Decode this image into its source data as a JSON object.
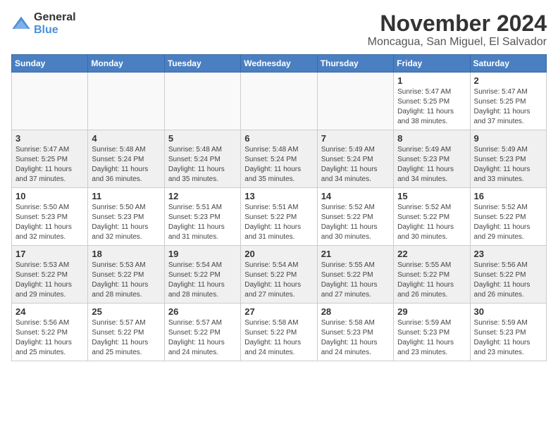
{
  "logo": {
    "general": "General",
    "blue": "Blue"
  },
  "header": {
    "month": "November 2024",
    "location": "Moncagua, San Miguel, El Salvador"
  },
  "weekdays": [
    "Sunday",
    "Monday",
    "Tuesday",
    "Wednesday",
    "Thursday",
    "Friday",
    "Saturday"
  ],
  "weeks": [
    [
      {
        "day": "",
        "info": ""
      },
      {
        "day": "",
        "info": ""
      },
      {
        "day": "",
        "info": ""
      },
      {
        "day": "",
        "info": ""
      },
      {
        "day": "",
        "info": ""
      },
      {
        "day": "1",
        "info": "Sunrise: 5:47 AM\nSunset: 5:25 PM\nDaylight: 11 hours\nand 38 minutes."
      },
      {
        "day": "2",
        "info": "Sunrise: 5:47 AM\nSunset: 5:25 PM\nDaylight: 11 hours\nand 37 minutes."
      }
    ],
    [
      {
        "day": "3",
        "info": "Sunrise: 5:47 AM\nSunset: 5:25 PM\nDaylight: 11 hours\nand 37 minutes."
      },
      {
        "day": "4",
        "info": "Sunrise: 5:48 AM\nSunset: 5:24 PM\nDaylight: 11 hours\nand 36 minutes."
      },
      {
        "day": "5",
        "info": "Sunrise: 5:48 AM\nSunset: 5:24 PM\nDaylight: 11 hours\nand 35 minutes."
      },
      {
        "day": "6",
        "info": "Sunrise: 5:48 AM\nSunset: 5:24 PM\nDaylight: 11 hours\nand 35 minutes."
      },
      {
        "day": "7",
        "info": "Sunrise: 5:49 AM\nSunset: 5:24 PM\nDaylight: 11 hours\nand 34 minutes."
      },
      {
        "day": "8",
        "info": "Sunrise: 5:49 AM\nSunset: 5:23 PM\nDaylight: 11 hours\nand 34 minutes."
      },
      {
        "day": "9",
        "info": "Sunrise: 5:49 AM\nSunset: 5:23 PM\nDaylight: 11 hours\nand 33 minutes."
      }
    ],
    [
      {
        "day": "10",
        "info": "Sunrise: 5:50 AM\nSunset: 5:23 PM\nDaylight: 11 hours\nand 32 minutes."
      },
      {
        "day": "11",
        "info": "Sunrise: 5:50 AM\nSunset: 5:23 PM\nDaylight: 11 hours\nand 32 minutes."
      },
      {
        "day": "12",
        "info": "Sunrise: 5:51 AM\nSunset: 5:23 PM\nDaylight: 11 hours\nand 31 minutes."
      },
      {
        "day": "13",
        "info": "Sunrise: 5:51 AM\nSunset: 5:22 PM\nDaylight: 11 hours\nand 31 minutes."
      },
      {
        "day": "14",
        "info": "Sunrise: 5:52 AM\nSunset: 5:22 PM\nDaylight: 11 hours\nand 30 minutes."
      },
      {
        "day": "15",
        "info": "Sunrise: 5:52 AM\nSunset: 5:22 PM\nDaylight: 11 hours\nand 30 minutes."
      },
      {
        "day": "16",
        "info": "Sunrise: 5:52 AM\nSunset: 5:22 PM\nDaylight: 11 hours\nand 29 minutes."
      }
    ],
    [
      {
        "day": "17",
        "info": "Sunrise: 5:53 AM\nSunset: 5:22 PM\nDaylight: 11 hours\nand 29 minutes."
      },
      {
        "day": "18",
        "info": "Sunrise: 5:53 AM\nSunset: 5:22 PM\nDaylight: 11 hours\nand 28 minutes."
      },
      {
        "day": "19",
        "info": "Sunrise: 5:54 AM\nSunset: 5:22 PM\nDaylight: 11 hours\nand 28 minutes."
      },
      {
        "day": "20",
        "info": "Sunrise: 5:54 AM\nSunset: 5:22 PM\nDaylight: 11 hours\nand 27 minutes."
      },
      {
        "day": "21",
        "info": "Sunrise: 5:55 AM\nSunset: 5:22 PM\nDaylight: 11 hours\nand 27 minutes."
      },
      {
        "day": "22",
        "info": "Sunrise: 5:55 AM\nSunset: 5:22 PM\nDaylight: 11 hours\nand 26 minutes."
      },
      {
        "day": "23",
        "info": "Sunrise: 5:56 AM\nSunset: 5:22 PM\nDaylight: 11 hours\nand 26 minutes."
      }
    ],
    [
      {
        "day": "24",
        "info": "Sunrise: 5:56 AM\nSunset: 5:22 PM\nDaylight: 11 hours\nand 25 minutes."
      },
      {
        "day": "25",
        "info": "Sunrise: 5:57 AM\nSunset: 5:22 PM\nDaylight: 11 hours\nand 25 minutes."
      },
      {
        "day": "26",
        "info": "Sunrise: 5:57 AM\nSunset: 5:22 PM\nDaylight: 11 hours\nand 24 minutes."
      },
      {
        "day": "27",
        "info": "Sunrise: 5:58 AM\nSunset: 5:22 PM\nDaylight: 11 hours\nand 24 minutes."
      },
      {
        "day": "28",
        "info": "Sunrise: 5:58 AM\nSunset: 5:23 PM\nDaylight: 11 hours\nand 24 minutes."
      },
      {
        "day": "29",
        "info": "Sunrise: 5:59 AM\nSunset: 5:23 PM\nDaylight: 11 hours\nand 23 minutes."
      },
      {
        "day": "30",
        "info": "Sunrise: 5:59 AM\nSunset: 5:23 PM\nDaylight: 11 hours\nand 23 minutes."
      }
    ]
  ]
}
